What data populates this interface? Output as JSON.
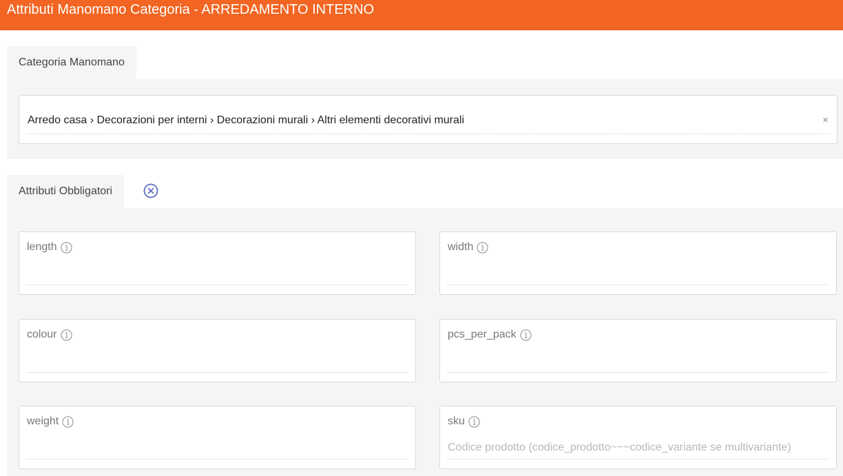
{
  "header": {
    "title": "Attributi Manomano Categoria - ARREDAMENTO INTERNO"
  },
  "category_section": {
    "tab_label": "Categoria Manomano",
    "selected_value": "Arredo casa › Decorazioni per interni › Decorazioni murali › Altri elementi decorativi murali",
    "clear_symbol": "×"
  },
  "attributes_section": {
    "tab_label": "Attributi Obbligatori",
    "fields": [
      {
        "label": "length",
        "value": "",
        "placeholder": ""
      },
      {
        "label": "width",
        "value": "",
        "placeholder": ""
      },
      {
        "label": "colour",
        "value": "",
        "placeholder": ""
      },
      {
        "label": "pcs_per_pack",
        "value": "",
        "placeholder": ""
      },
      {
        "label": "weight",
        "value": "",
        "placeholder": ""
      },
      {
        "label": "sku",
        "value": "",
        "placeholder": "Codice prodotto (codice_prodotto~~~codice_variante se multivariante)"
      }
    ]
  },
  "colors": {
    "header_bg": "#f26522",
    "panel_bg": "#f5f5f5",
    "close_icon": "#5c6bc0"
  }
}
